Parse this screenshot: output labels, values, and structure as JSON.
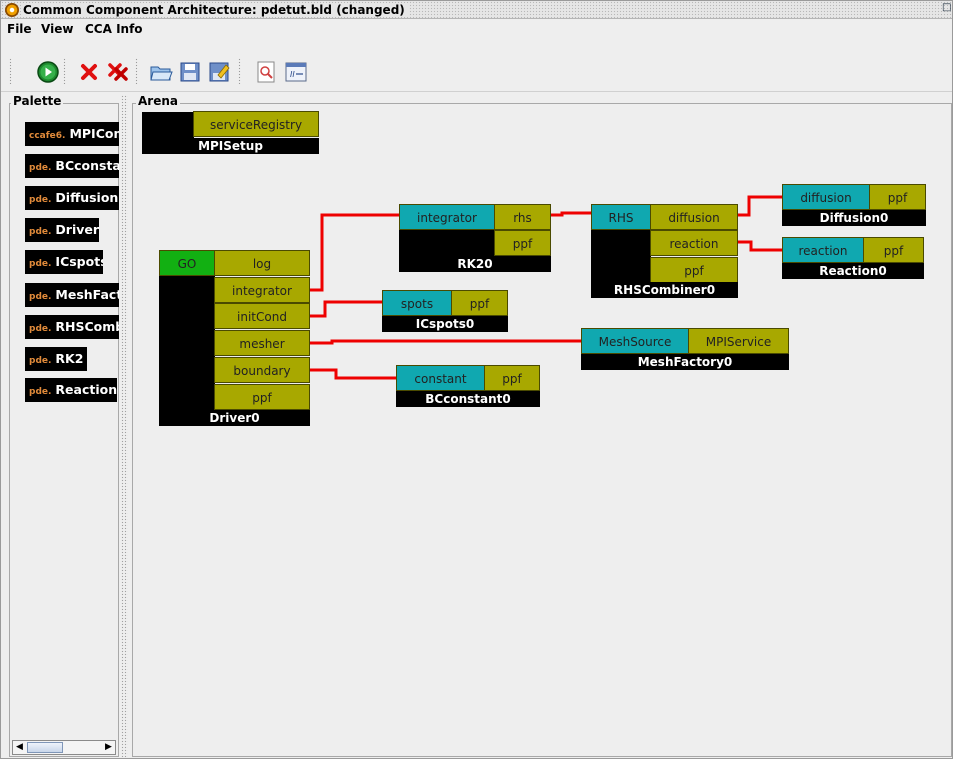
{
  "window": {
    "title": "Common Component Architecture: pdetut.bld (changed)"
  },
  "menu": [
    "File",
    "View",
    "CCA Info"
  ],
  "toolbar": {
    "buttons": [
      {
        "name": "run-button",
        "icon": "go-icon"
      },
      {
        "name": "remove-button",
        "icon": "delete-icon"
      },
      {
        "name": "remove-all-button",
        "icon": "delete-all-icon"
      },
      {
        "name": "open-button",
        "icon": "folder-open-icon"
      },
      {
        "name": "save-button",
        "icon": "save-icon"
      },
      {
        "name": "save-as-button",
        "icon": "save-as-icon"
      },
      {
        "name": "print-button",
        "icon": "print-preview-icon"
      },
      {
        "name": "script-button",
        "icon": "script-window-icon"
      }
    ]
  },
  "palette": {
    "label": "Palette",
    "items": [
      {
        "prefix": "ccafe6.",
        "name": "MPIComponent"
      },
      {
        "prefix": "pde.",
        "name": "BCconstant"
      },
      {
        "prefix": "pde.",
        "name": "Diffusion"
      },
      {
        "prefix": "pde.",
        "name": "Driver"
      },
      {
        "prefix": "pde.",
        "name": "ICspots"
      },
      {
        "prefix": "pde.",
        "name": "MeshFactory"
      },
      {
        "prefix": "pde.",
        "name": "RHSCombiner"
      },
      {
        "prefix": "pde.",
        "name": "RK2"
      },
      {
        "prefix": "pde.",
        "name": "Reaction"
      }
    ]
  },
  "arena": {
    "label": "Arena",
    "components": {
      "mpisetup": {
        "name": "MPISetup",
        "uses": [
          "serviceRegistry"
        ]
      },
      "driver": {
        "name": "Driver0",
        "go": "GO",
        "uses": [
          "log",
          "integrator",
          "initCond",
          "mesher",
          "boundary",
          "ppf"
        ]
      },
      "rk2": {
        "name": "RK20",
        "provides": [
          "integrator"
        ],
        "uses": [
          "rhs",
          "ppf"
        ]
      },
      "rhscombiner": {
        "name": "RHSCombiner0",
        "provides": [
          "RHS"
        ],
        "uses": [
          "diffusion",
          "reaction",
          "ppf"
        ]
      },
      "diffusion": {
        "name": "Diffusion0",
        "provides": [
          "diffusion"
        ],
        "uses": [
          "ppf"
        ]
      },
      "reaction": {
        "name": "Reaction0",
        "provides": [
          "reaction"
        ],
        "uses": [
          "ppf"
        ]
      },
      "icspots": {
        "name": "ICspots0",
        "provides": [
          "spots"
        ],
        "uses": [
          "ppf"
        ]
      },
      "meshfactory": {
        "name": "MeshFactory0",
        "provides": [
          "MeshSource"
        ],
        "uses": [
          "MPIService"
        ]
      },
      "bcconstant": {
        "name": "BCconstant0",
        "provides": [
          "constant"
        ],
        "uses": [
          "ppf"
        ]
      }
    },
    "connections": [
      {
        "from": "Driver0.integrator",
        "to": "RK20.integrator"
      },
      {
        "from": "Driver0.initCond",
        "to": "ICspots0.spots"
      },
      {
        "from": "Driver0.mesher",
        "to": "MeshFactory0.MeshSource"
      },
      {
        "from": "Driver0.boundary",
        "to": "BCconstant0.constant"
      },
      {
        "from": "RK20.rhs",
        "to": "RHSCombiner0.RHS"
      },
      {
        "from": "RHSCombiner0.diffusion",
        "to": "Diffusion0.diffusion"
      },
      {
        "from": "RHSCombiner0.reaction",
        "to": "Reaction0.reaction"
      }
    ],
    "colors": {
      "uses_port": "#a8a800",
      "provides_port": "#10a8b0",
      "go_port": "#12b012",
      "wire": "#ee0000"
    }
  }
}
